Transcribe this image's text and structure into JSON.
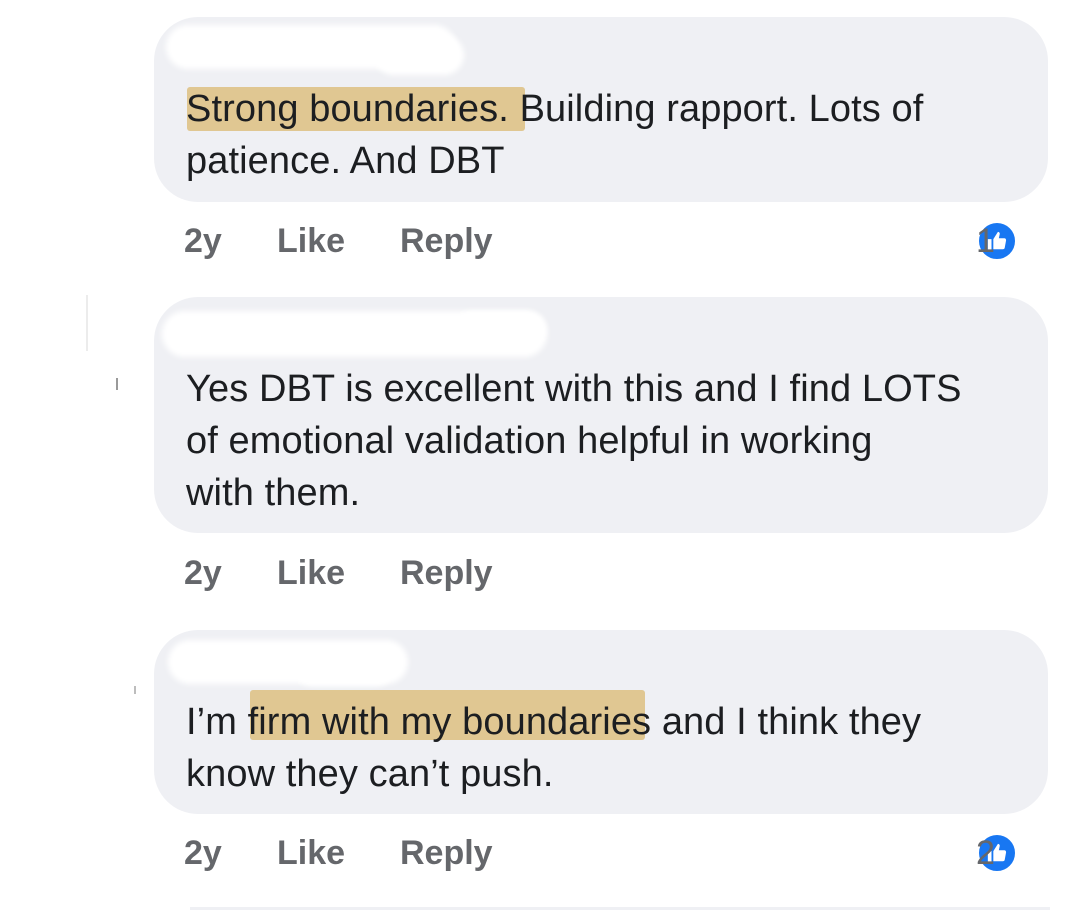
{
  "comments": [
    {
      "text_line1": "Strong boundaries. Building rapport. Lots of",
      "text_line2": "patience. And DBT",
      "text_line3": "",
      "time": "2y",
      "like_label": "Like",
      "reply_label": "Reply",
      "reaction_count": "1",
      "reaction_icon": "thumbs-up-icon"
    },
    {
      "text_line1": "Yes DBT is excellent with this and I find LOTS",
      "text_line2": "of emotional validation helpful in working",
      "text_line3": "with them.",
      "time": "2y",
      "like_label": "Like",
      "reply_label": "Reply",
      "reaction_count": "",
      "reaction_icon": ""
    },
    {
      "text_line1": "I’m firm with my boundaries and I think they",
      "text_line2": "know they can’t push.",
      "text_line3": "",
      "time": "2y",
      "like_label": "Like",
      "reply_label": "Reply",
      "reaction_count": "2",
      "reaction_icon": "thumbs-up-icon"
    }
  ],
  "colors": {
    "bubble_background": "#eff0f4",
    "action_text": "#65676b",
    "like_badge": "#1877f2",
    "highlight": "#e2b046"
  }
}
